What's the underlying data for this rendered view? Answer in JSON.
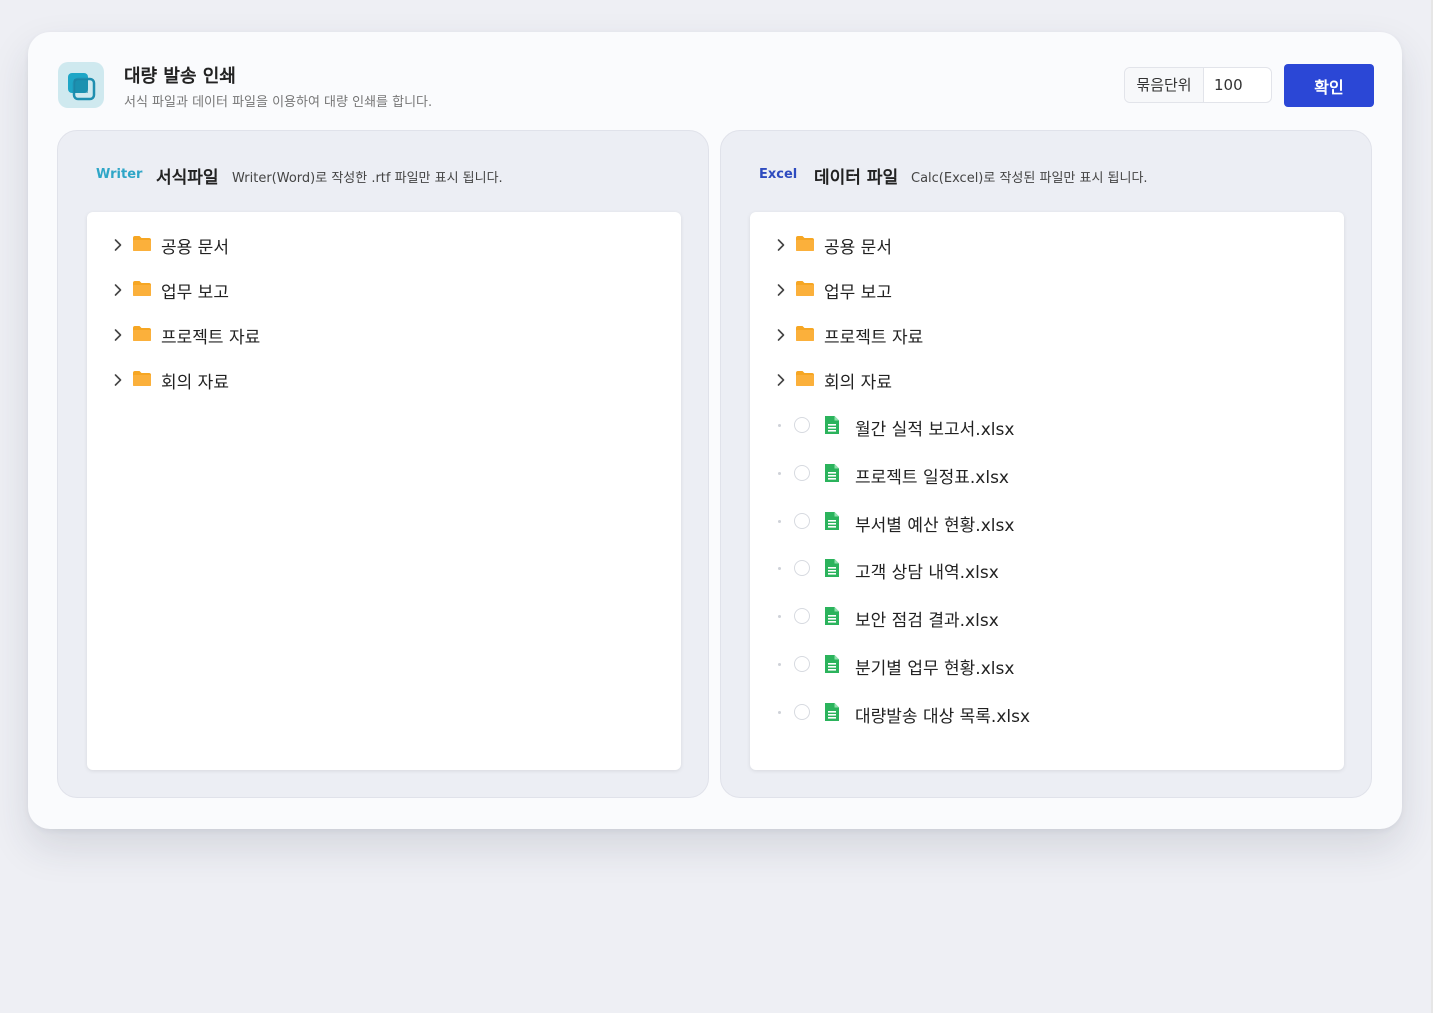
{
  "header": {
    "title": "대량 발송 인쇄",
    "subtitle": "서식 파일과 데이터 파일을 이용하여 대량 인쇄를 합니다.",
    "icon": "copy-layers-icon",
    "unit_label": "묶음단위",
    "unit_value": "100",
    "confirm_label": "확인",
    "accent_color": "#2b47d6"
  },
  "left_panel": {
    "tag": "Writer",
    "title": "서식파일",
    "description": "Writer(Word)로 작성한 .rtf 파일만 표시 됩니다.",
    "folders": [
      "공용 문서",
      "업무 보고",
      "프로젝트 자료",
      "회의 자료"
    ]
  },
  "right_panel": {
    "tag": "Excel",
    "title": "데이터 파일",
    "description": "Calc(Excel)로 작성된 파일만 표시 됩니다.",
    "folders": [
      "공용 문서",
      "업무 보고",
      "프로젝트 자료",
      "회의 자료"
    ],
    "files": [
      "월간 실적 보고서.xlsx",
      "프로젝트 일정표.xlsx",
      "부서별 예산 현황.xlsx",
      "고객 상담 내역.xlsx",
      "보안 점검 결과.xlsx",
      "분기별 업무 현황.xlsx",
      "대량발송 대상 목록.xlsx"
    ]
  }
}
